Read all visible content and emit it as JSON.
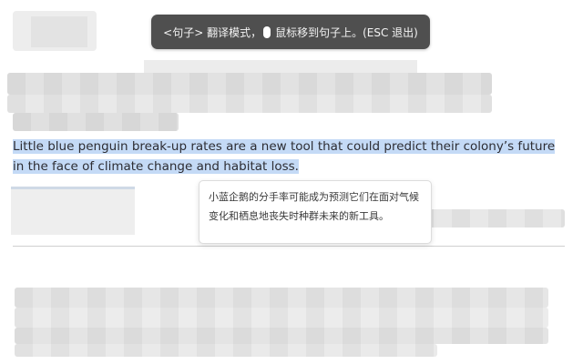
{
  "toast": {
    "prefix": "<句子> 翻译模式，",
    "suffix": "鼠标移到句子上。(ESC 退出)"
  },
  "sentence": {
    "text": "Little blue penguin break-up rates are a new tool that could predict their colony’s future in the face of climate change and habitat loss."
  },
  "translation": {
    "text": "小蓝企鹅的分手率可能成为预测它们在面对气候变化和栖息地丧失时种群未来的新工具。"
  },
  "colors": {
    "highlight": "#c4daf6",
    "toast_bg": "#4f4f4f"
  }
}
